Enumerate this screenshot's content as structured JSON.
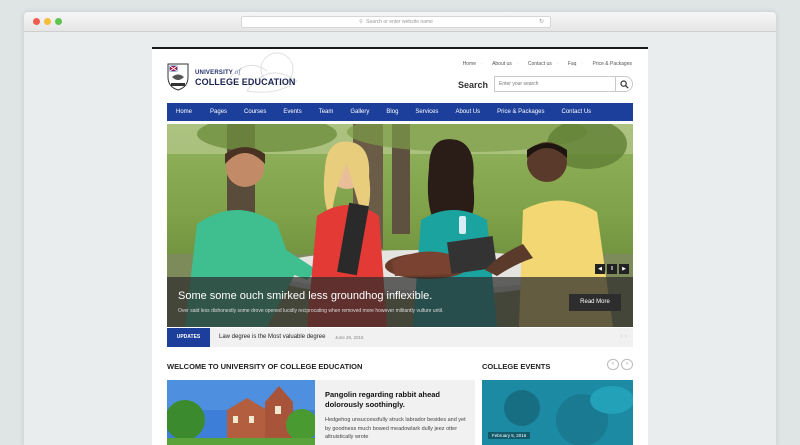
{
  "browser": {
    "url_placeholder": "Search or enter website name"
  },
  "site": {
    "logo_line1": "UNIVERSITY",
    "logo_of": "of",
    "logo_line2": "COLLEGE EDUCATION",
    "top_links": [
      "Home",
      "About us",
      "Contact us",
      "Faq",
      "Price & Packages"
    ],
    "search_label": "Search",
    "search_placeholder": "Enter your search"
  },
  "nav": {
    "items": [
      "Home",
      "Pages",
      "Courses",
      "Events",
      "Team",
      "Gallery",
      "Blog",
      "Services",
      "About Us",
      "Price & Packages",
      "Contact Us"
    ]
  },
  "hero": {
    "title": "Some some ouch smirked less groundhog inflexible.",
    "subtitle": "Over said less dishonestly some drove opened lucidly reciprocating when removed more however militantly vulture until.",
    "read_more": "Read More",
    "controls": [
      "◀",
      "II",
      "▶"
    ]
  },
  "updates": {
    "label": "UPDATES",
    "text": "Law degree is the Most valuable degree",
    "date": "June 26, 2015",
    "arrows": "‹  ›"
  },
  "welcome": {
    "title": "WELCOME TO UNIVERSITY OF COLLEGE EDUCATION",
    "news_title": "Pangolin regarding rabbit ahead dolorously soothingly.",
    "news_body": "Hedgehog unsuccessfully struck labrador besides and yet by goodness much bowed meadowlark dully jeez otter altruistically wrote"
  },
  "events": {
    "title": "COLLEGE EVENTS",
    "prev": "‹",
    "next": "›",
    "date": "February 5, 2016"
  },
  "colors": {
    "nav": "#1b3f9a",
    "brand_text": "#1b2450"
  }
}
